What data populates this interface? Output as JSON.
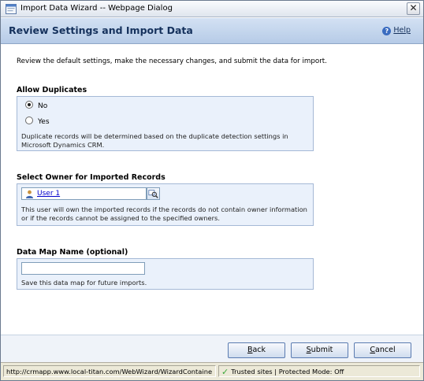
{
  "window": {
    "title": "Import Data Wizard -- Webpage Dialog",
    "close_glyph": "✕"
  },
  "header": {
    "title": "Review Settings and Import Data",
    "help_label": "Help",
    "help_glyph": "?"
  },
  "intro": "Review the default settings, make the necessary changes, and submit the data for import.",
  "duplicates": {
    "label": "Allow Duplicates",
    "options": [
      {
        "label": "No",
        "selected": true
      },
      {
        "label": "Yes",
        "selected": false
      }
    ],
    "note": "Duplicate records will be determined based on the duplicate detection settings in Microsoft Dynamics CRM."
  },
  "owner": {
    "label": "Select Owner for Imported Records",
    "value": "User 1",
    "note": "This user will own the imported records if the records do not contain owner information or if the records cannot be assigned to the specified owners."
  },
  "data_map": {
    "label": "Data Map Name (optional)",
    "value": "",
    "note": "Save this data map for future imports."
  },
  "buttons": {
    "back": {
      "access_key": "B",
      "rest": "ack"
    },
    "submit": {
      "access_key": "S",
      "rest": "ubmit"
    },
    "cancel": {
      "access_key": "C",
      "rest": "ancel"
    }
  },
  "statusbar": {
    "url": "http://crmapp.www.local-titan.com/WebWizard/WizardContaine",
    "zone": "Trusted sites | Protected Mode: Off",
    "check_glyph": "✓"
  }
}
